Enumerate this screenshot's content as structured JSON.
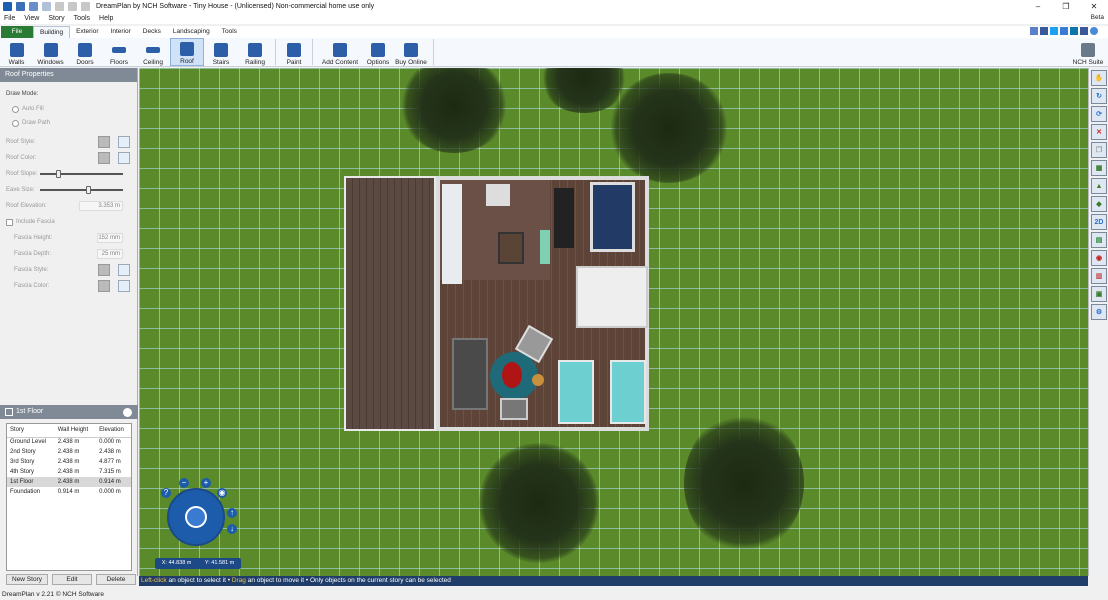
{
  "window": {
    "title": "DreamPlan by NCH Software - Tiny House - (Unlicensed) Non-commercial home use only",
    "beta": "Beta"
  },
  "menu": [
    "File",
    "View",
    "Story",
    "Tools",
    "Help"
  ],
  "tabs": {
    "file": "File",
    "items": [
      "Building",
      "Exterior",
      "Interior",
      "Decks",
      "Landscaping",
      "Tools"
    ]
  },
  "ribbon": {
    "items": [
      {
        "label": "Walls",
        "icon": "walls-icon",
        "color": "#2d5fa8"
      },
      {
        "label": "Windows",
        "icon": "windows-icon",
        "color": "#2d5fa8"
      },
      {
        "label": "Doors",
        "icon": "doors-icon",
        "color": "#2d5fa8"
      },
      {
        "label": "Floors",
        "icon": "floors-icon",
        "color": "#2d5fa8"
      },
      {
        "label": "Ceiling",
        "icon": "ceiling-icon",
        "color": "#2d5fa8"
      },
      {
        "label": "Roof",
        "icon": "roof-icon",
        "color": "#2d5fa8"
      },
      {
        "label": "Stairs",
        "icon": "stairs-icon",
        "color": "#2d5fa8"
      },
      {
        "label": "Railing",
        "icon": "railing-icon",
        "color": "#2d5fa8"
      },
      {
        "label": "Paint",
        "icon": "paint-icon",
        "color": "#2d5fa8"
      },
      {
        "label": "Add Content",
        "icon": "add-content-icon",
        "color": "#2d5fa8"
      },
      {
        "label": "Options",
        "icon": "options-icon",
        "color": "#2d5fa8"
      },
      {
        "label": "Buy Online",
        "icon": "buy-online-icon",
        "color": "#2d5fa8"
      }
    ],
    "suite": "NCH Suite"
  },
  "roof": {
    "title": "Roof Properties",
    "draw_mode": "Draw Mode:",
    "auto_fill": "Auto Fill",
    "draw_path": "Draw Path",
    "roof_style": "Roof Style:",
    "roof_color": "Roof Color:",
    "roof_slope": "Roof Slope:",
    "eave_size": "Eave Size:",
    "roof_elevation": "Roof Elevation:",
    "roof_elevation_value": "3.353 m",
    "include_fascia": "Include Fascia",
    "fascia_height": "Fascia Height:",
    "fascia_height_value": "152 mm",
    "fascia_depth": "Fascia Depth:",
    "fascia_depth_value": "25 mm",
    "fascia_style": "Fascia Style:",
    "fascia_color": "Fascia Color:"
  },
  "story": {
    "title": "1st Floor",
    "headers": [
      "Story",
      "Wall Height",
      "Elevation"
    ],
    "rows": [
      [
        "Ground Level",
        "2.438 m",
        "0.000 m"
      ],
      [
        "2nd Story",
        "2.438 m",
        "2.438 m"
      ],
      [
        "3rd Story",
        "2.438 m",
        "4.877 m"
      ],
      [
        "4th Story",
        "2.438 m",
        "7.315 m"
      ],
      [
        "1st Floor",
        "2.438 m",
        "0.914 m"
      ],
      [
        "Foundation",
        "0.914 m",
        "0.000 m"
      ]
    ],
    "buttons": [
      "New Story",
      "Edit",
      "Delete"
    ]
  },
  "coords": {
    "x": "X: 44.838 m",
    "y": "Y: 41.581 m"
  },
  "status": {
    "a": "Left-click",
    "b": " an object to select it • ",
    "c": "Drag",
    "d": " an object to move it • Only objects on the current story can be selected"
  },
  "footer": "DreamPlan v 2.21 © NCH Software",
  "right_tools": [
    {
      "name": "hand-tool-icon",
      "glyph": "✋"
    },
    {
      "name": "orbit-icon",
      "glyph": "↻"
    },
    {
      "name": "rotate-icon",
      "glyph": "⟳"
    },
    {
      "name": "delete-icon",
      "glyph": "✕"
    },
    {
      "name": "copy-icon",
      "glyph": "❐"
    },
    {
      "name": "layer-icon",
      "glyph": "▦"
    },
    {
      "name": "terrain-icon",
      "glyph": "▲"
    },
    {
      "name": "landscape-icon",
      "glyph": "◆"
    },
    {
      "name": "view-2d-icon",
      "glyph": "2D"
    },
    {
      "name": "grid-icon",
      "glyph": "▤"
    },
    {
      "name": "paint-bucket-icon",
      "glyph": "◉"
    },
    {
      "name": "floorplan-icon",
      "glyph": "▥"
    },
    {
      "name": "camera-view-icon",
      "glyph": "▣"
    },
    {
      "name": "settings-icon",
      "glyph": "⚙"
    }
  ]
}
